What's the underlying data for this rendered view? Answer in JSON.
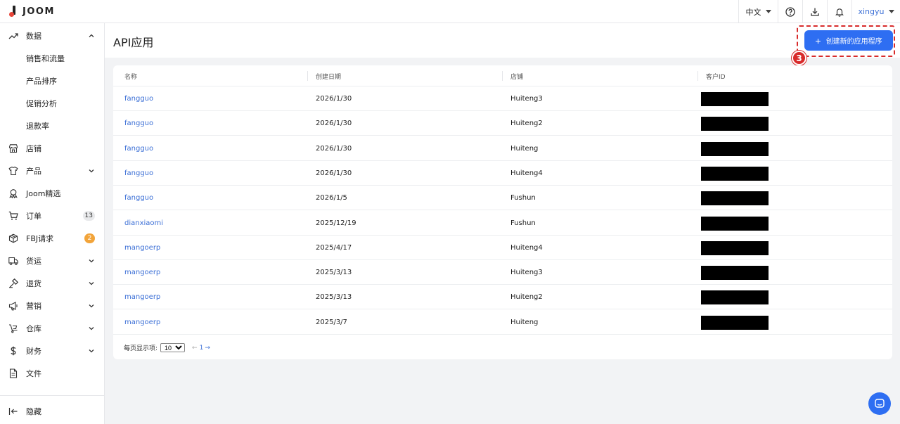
{
  "brand": {
    "name": "JOOM"
  },
  "topbar": {
    "language": "中文",
    "icons": [
      "help-circle-icon",
      "download-icon",
      "bell-icon"
    ],
    "user": "xingyu"
  },
  "sidebar": {
    "items": [
      {
        "label": "数据",
        "icon": "trend-up-icon",
        "expanded": true
      },
      {
        "label": "销售和流量"
      },
      {
        "label": "产品排序"
      },
      {
        "label": "促销分析"
      },
      {
        "label": "退款率"
      },
      {
        "label": "店铺",
        "icon": "store-icon"
      },
      {
        "label": "产品",
        "icon": "shirt-icon"
      },
      {
        "label": "Joom精选",
        "icon": "award-icon"
      },
      {
        "label": "订单",
        "icon": "cart-icon",
        "badge": "13"
      },
      {
        "label": "FBJ请求",
        "icon": "package-icon",
        "badge": "2"
      },
      {
        "label": "货运",
        "icon": "truck-icon"
      },
      {
        "label": "退货",
        "icon": "hammer-icon"
      },
      {
        "label": "营销",
        "icon": "megaphone-icon"
      },
      {
        "label": "仓库",
        "icon": "warehouse-icon"
      },
      {
        "label": "财务",
        "icon": "dollar-icon"
      },
      {
        "label": "文件",
        "icon": "file-icon"
      }
    ],
    "collapse_label": "隐藏"
  },
  "page": {
    "title": "API应用",
    "create_button": "创建新的应用程序",
    "step_number": "3"
  },
  "table": {
    "columns": [
      "名称",
      "创建日期",
      "店铺",
      "客户ID"
    ],
    "rows": [
      {
        "name": "fangguo",
        "date": "2026/1/30",
        "store": "Huiteng3"
      },
      {
        "name": "fangguo",
        "date": "2026/1/30",
        "store": "Huiteng2"
      },
      {
        "name": "fangguo",
        "date": "2026/1/30",
        "store": "Huiteng"
      },
      {
        "name": "fangguo",
        "date": "2026/1/30",
        "store": "Huiteng4"
      },
      {
        "name": "fangguo",
        "date": "2026/1/5",
        "store": "Fushun"
      },
      {
        "name": "dianxiaomi",
        "date": "2025/12/19",
        "store": "Fushun"
      },
      {
        "name": "mangoerp",
        "date": "2025/4/17",
        "store": "Huiteng4"
      },
      {
        "name": "mangoerp",
        "date": "2025/3/13",
        "store": "Huiteng3"
      },
      {
        "name": "mangoerp",
        "date": "2025/3/13",
        "store": "Huiteng2"
      },
      {
        "name": "mangoerp",
        "date": "2025/3/7",
        "store": "Huiteng"
      }
    ]
  },
  "pagination": {
    "per_page_label": "每页显示项:",
    "per_page_value": "10",
    "page": "1",
    "prev": "←",
    "next": "→"
  },
  "colors": {
    "accent": "#2e6ef2",
    "link": "#3b6fd6",
    "highlight": "#d82b2b",
    "badge_orange": "#f2a43a"
  }
}
